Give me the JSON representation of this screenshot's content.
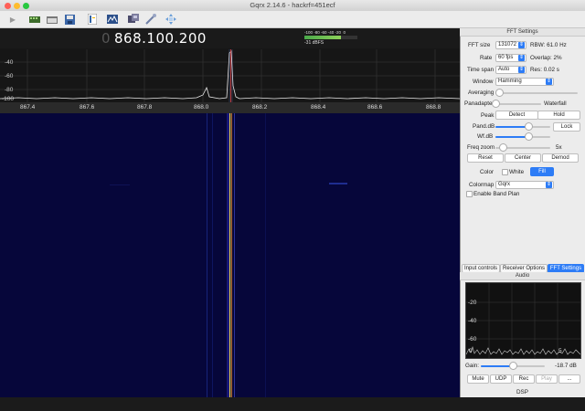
{
  "window": {
    "title": "Gqrx 2.14.6 - hackrf=451ecf"
  },
  "toolbar": {
    "icons": [
      "play-icon",
      "hardware-icon",
      "folder-icon",
      "save-icon",
      "document-icon",
      "sdr-icon",
      "hardware-config-icon",
      "tools-icon",
      "fullscreen-icon"
    ]
  },
  "frequency": {
    "leading": "0",
    "display": "868.100.200"
  },
  "signal_meter": {
    "scale": "-100 -80 -60 -40 -20  0",
    "readout": "-31 dBFS"
  },
  "spectrum": {
    "y_ticks": [
      "-40",
      "-60",
      "-80",
      "-100"
    ],
    "x_ticks": [
      "867.4",
      "867.6",
      "867.8",
      "868.0",
      "868.2",
      "868.4",
      "868.6",
      "868.8"
    ]
  },
  "fft_settings": {
    "header": "FFT Settings",
    "fft_size_label": "FFT size",
    "fft_size_value": "131072",
    "rbw": "RBW: 61.0 Hz",
    "rate_label": "Rate",
    "rate_value": "60 fps",
    "overlap": "Overlap: 2%",
    "timespan_label": "Time span",
    "timespan_value": "Auto",
    "res": "Res: 0.02 s",
    "window_label": "Window",
    "window_value": "Hamming",
    "averaging_label": "Averaging",
    "averaging_level": 0.0,
    "panadapter_label": "Panadapter",
    "waterfall_label": "Waterfall",
    "pan_wf_split": 0.0,
    "peak_label": "Peak",
    "detect_button": "Detect",
    "hold_button": "Hold",
    "pand_db_label": "Pand.dB",
    "pand_db_level": 0.6,
    "lock_button": "Lock",
    "wf_db_label": "Wf.dB",
    "wf_db_level": 0.6,
    "freq_zoom_label": "Freq zoom",
    "freq_zoom_level": 0.07,
    "freq_zoom_value": "5x",
    "reset_button": "Reset",
    "center_button": "Center",
    "demod_button": "Demod",
    "color_label": "Color",
    "white_label": "White",
    "fill_button": "Fill",
    "colormap_label": "Colormap",
    "colormap_value": "Gqrx",
    "band_plan_label": "Enable Band Plan"
  },
  "tabs": [
    "Input controls",
    "Receiver Options",
    "FFT Settings"
  ],
  "audio": {
    "header": "Audio",
    "y_ticks": [
      "-20",
      "-40",
      "-60"
    ],
    "x_ticks": [
      "0",
      "5"
    ],
    "gain_label": "Gain:",
    "gain_level": 0.5,
    "gain_value": "-18.7 dB",
    "buttons": [
      "Mute",
      "UDP",
      "Rec",
      "Play",
      "..."
    ],
    "dsp_label": "DSP"
  },
  "colors": {
    "accent": "#2d7cf6",
    "waterfall_bg": "#06063a",
    "spectrum_bg": "#161616"
  }
}
